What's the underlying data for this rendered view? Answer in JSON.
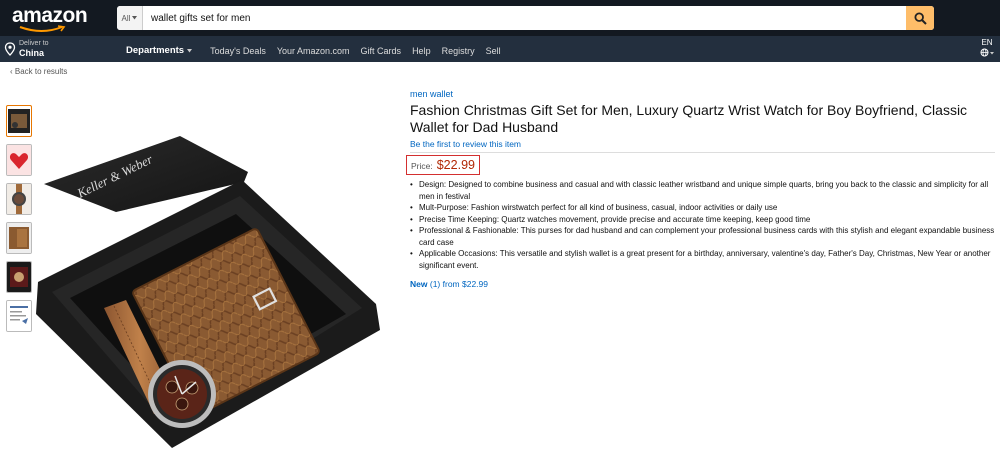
{
  "header": {
    "logo": "amazon",
    "search": {
      "scope": "All",
      "query": "wallet gifts set for men"
    },
    "deliver": {
      "line1": "Deliver to",
      "line2": "China"
    },
    "nav": {
      "departments": "Departments",
      "links": [
        "Today's Deals",
        "Your Amazon.com",
        "Gift Cards",
        "Help",
        "Registry",
        "Sell"
      ]
    },
    "lang": "EN"
  },
  "breadcrumb": "‹ Back to results",
  "gallery": {
    "thumbnails": [
      "gift-box-set",
      "heart-card",
      "watch-on-wrist",
      "wallet-brown",
      "watch-face",
      "info-sheet"
    ],
    "main_image": {
      "box_brand": "Keller & Weber"
    }
  },
  "product": {
    "category_link": "men wallet",
    "title": "Fashion Christmas Gift Set for Men, Luxury Quartz Wrist Watch for Boy Boyfriend, Classic Wallet for Dad Husband",
    "review_link": "Be the first to review this item",
    "price_label": "Price:",
    "price": "$22.99",
    "bullets": [
      "Design: Designed to combine business and casual and with classic leather wristband and unique simple quarts, bring you back to the classic and simplicity for all men in festival",
      "Mult-Purpose: Fashion wirstwatch perfect for all kind of business, casual, indoor activities or daily use",
      "Precise Time Keeping: Quartz watches movement, provide precise and accurate time keeping, keep good time",
      "Professional & Fashionable: This purses for dad husband and can complement your professional business cards with this stylish and elegant expandable business card case",
      "Applicable Occasions: This versatile and stylish wallet is a great present for a birthday, anniversary, valentine's day, Father's Day, Christmas, New Year or another significant event."
    ],
    "offers": {
      "new_label": "New",
      "count": "(1)",
      "from_text": "from $22.99"
    }
  },
  "colors": {
    "nav_top": "#131921",
    "nav_bottom": "#232f3e",
    "search_button": "#febd69",
    "link": "#0066c0",
    "price": "#b12704",
    "price_box_border": "#d32f2f"
  }
}
